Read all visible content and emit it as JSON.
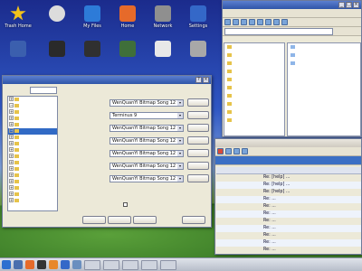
{
  "desktop_icons": [
    {
      "label": "Trash Home",
      "icon": "star-icon",
      "color": "#f2c21b"
    },
    {
      "label": "",
      "icon": "cd-icon",
      "color": "#dcdcdc"
    },
    {
      "label": "My Files",
      "icon": "folder-icon",
      "color": "#2d7bd8"
    },
    {
      "label": "Home",
      "icon": "home-icon",
      "color": "#e66a2a"
    },
    {
      "label": "Network",
      "icon": "network-icon",
      "color": "#8f8f8f"
    },
    {
      "label": "Settings",
      "icon": "gear-icon",
      "color": "#3468c8"
    },
    {
      "label": "",
      "icon": "monitor-icon",
      "color": "#3b5fae"
    },
    {
      "label": "",
      "icon": "disk-icon",
      "color": "#2a2a2a"
    },
    {
      "label": "",
      "icon": "terminal-icon",
      "color": "#303030"
    },
    {
      "label": "",
      "icon": "hardware-icon",
      "color": "#3f6f3a"
    },
    {
      "label": "",
      "icon": "document-icon",
      "color": "#e8e8e8"
    },
    {
      "label": "",
      "icon": "printer-icon",
      "color": "#a8a8a8"
    },
    {
      "label": "",
      "icon": "floppy-icon",
      "color": "#414b7a"
    }
  ],
  "dialog": {
    "title": "",
    "search_label": "",
    "section_title": "",
    "tree": [
      {
        "label": "",
        "expanded": false
      },
      {
        "label": "",
        "expanded": true
      },
      {
        "label": "",
        "expanded": false
      },
      {
        "label": "",
        "expanded": false
      },
      {
        "label": "",
        "expanded": false
      },
      {
        "label": "",
        "expanded": true,
        "selected": true
      },
      {
        "label": "",
        "expanded": false
      },
      {
        "label": "",
        "expanded": false
      },
      {
        "label": "",
        "expanded": false
      },
      {
        "label": "",
        "expanded": false
      },
      {
        "label": "",
        "expanded": false
      },
      {
        "label": "",
        "expanded": false
      },
      {
        "label": "",
        "expanded": false
      },
      {
        "label": "",
        "expanded": false
      },
      {
        "label": "",
        "expanded": false
      },
      {
        "label": "",
        "expanded": false
      },
      {
        "label": "",
        "expanded": false
      }
    ],
    "fields": [
      {
        "label": "",
        "value": "WenQuanYi Bitmap Song 12"
      },
      {
        "label": "",
        "value": "Terminus 9"
      },
      {
        "label": "",
        "value": "WenQuanYi Bitmap Song 12"
      },
      {
        "label": "",
        "value": "WenQuanYi Bitmap Song 12"
      },
      {
        "label": "",
        "value": "WenQuanYi Bitmap Song 12"
      },
      {
        "label": "",
        "value": "WenQuanYi Bitmap Song 12"
      },
      {
        "label": "",
        "value": "WenQuanYi Bitmap Song 12"
      }
    ],
    "choose_label": "",
    "adjust_label": "",
    "checkbox_label": "",
    "buttons": [
      "",
      "",
      "",
      ""
    ]
  },
  "browser": {
    "title": "",
    "folders": [
      "",
      "",
      "",
      "",
      "",
      "",
      "",
      "",
      "",
      ""
    ],
    "items": [
      "",
      "",
      ""
    ]
  },
  "mail": {
    "title": "",
    "headers": [
      "",
      "",
      ""
    ],
    "rows": [
      {
        "date": "",
        "from": "",
        "subject": "Re: [help] ..."
      },
      {
        "date": "",
        "from": "",
        "subject": "Re: [help] ..."
      },
      {
        "date": "",
        "from": "",
        "subject": "Re: [help] ..."
      },
      {
        "date": "",
        "from": "",
        "subject": "Re: ..."
      },
      {
        "date": "",
        "from": "",
        "subject": "Re: ..."
      },
      {
        "date": "",
        "from": "",
        "subject": "Re: ..."
      },
      {
        "date": "",
        "from": "",
        "subject": "Re: ..."
      },
      {
        "date": "",
        "from": "",
        "subject": "Re: ..."
      },
      {
        "date": "",
        "from": "",
        "subject": "Re: ..."
      },
      {
        "date": "",
        "from": "",
        "subject": "Re: ..."
      },
      {
        "date": "",
        "from": "",
        "subject": "Re: ..."
      },
      {
        "date": "",
        "from": "",
        "subject": "Re: ..."
      }
    ]
  },
  "taskbar": {
    "clock": "",
    "launchers": [
      "kde-icon",
      "monitor-icon",
      "home-icon",
      "terminal-icon",
      "firefox-icon",
      "gear-icon",
      "network-icon"
    ]
  }
}
